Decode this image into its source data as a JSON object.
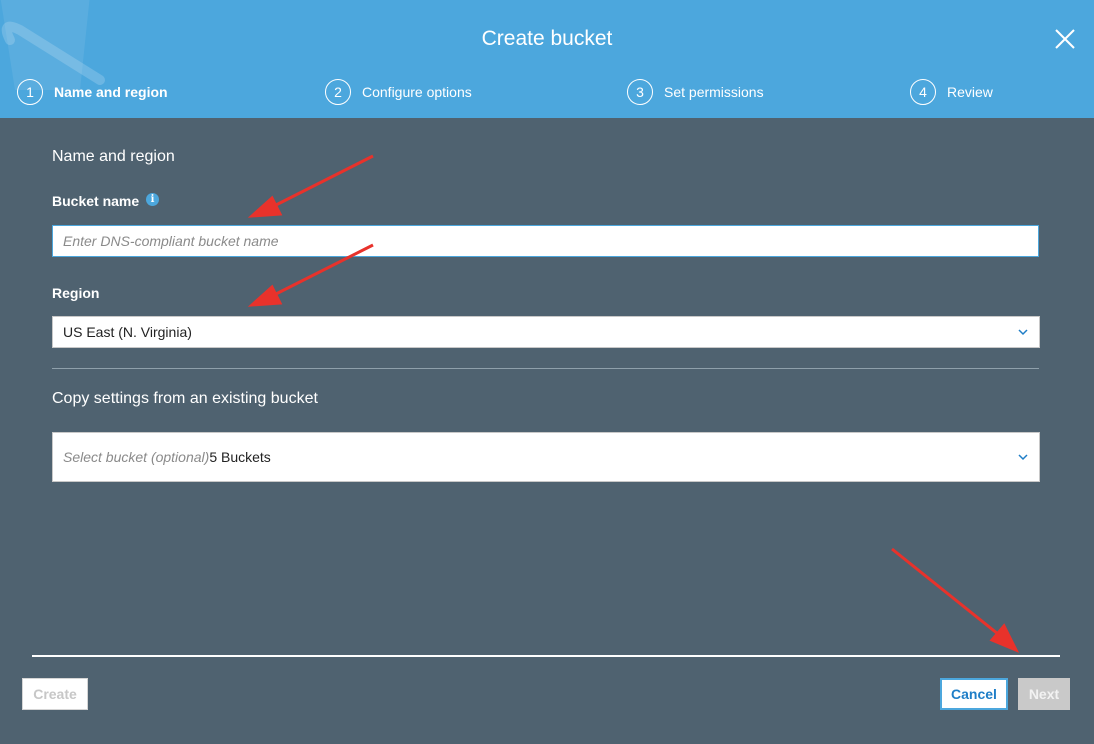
{
  "dialog": {
    "title": "Create bucket"
  },
  "steps": [
    {
      "number": "1",
      "label": "Name and region",
      "active": true
    },
    {
      "number": "2",
      "label": "Configure options",
      "active": false
    },
    {
      "number": "3",
      "label": "Set permissions",
      "active": false
    },
    {
      "number": "4",
      "label": "Review",
      "active": false
    }
  ],
  "form": {
    "section_title": "Name and region",
    "bucket_name_label": "Bucket name",
    "bucket_name_placeholder": "Enter DNS-compliant bucket name",
    "bucket_name_value": "",
    "region_label": "Region",
    "region_value": "US East (N. Virginia)",
    "copy_title": "Copy settings from an existing bucket",
    "copy_placeholder": "Select bucket (optional)",
    "copy_count": "5 Buckets"
  },
  "footer": {
    "create_label": "Create",
    "cancel_label": "Cancel",
    "next_label": "Next"
  },
  "icons": {
    "close": "close-icon",
    "info": "info-icon",
    "chevron": "chevron-down-icon"
  },
  "colors": {
    "header": "#4ca7dd",
    "body": "#4f6270",
    "accent": "#1f7ec7",
    "annotation_arrow": "#e8322b"
  }
}
